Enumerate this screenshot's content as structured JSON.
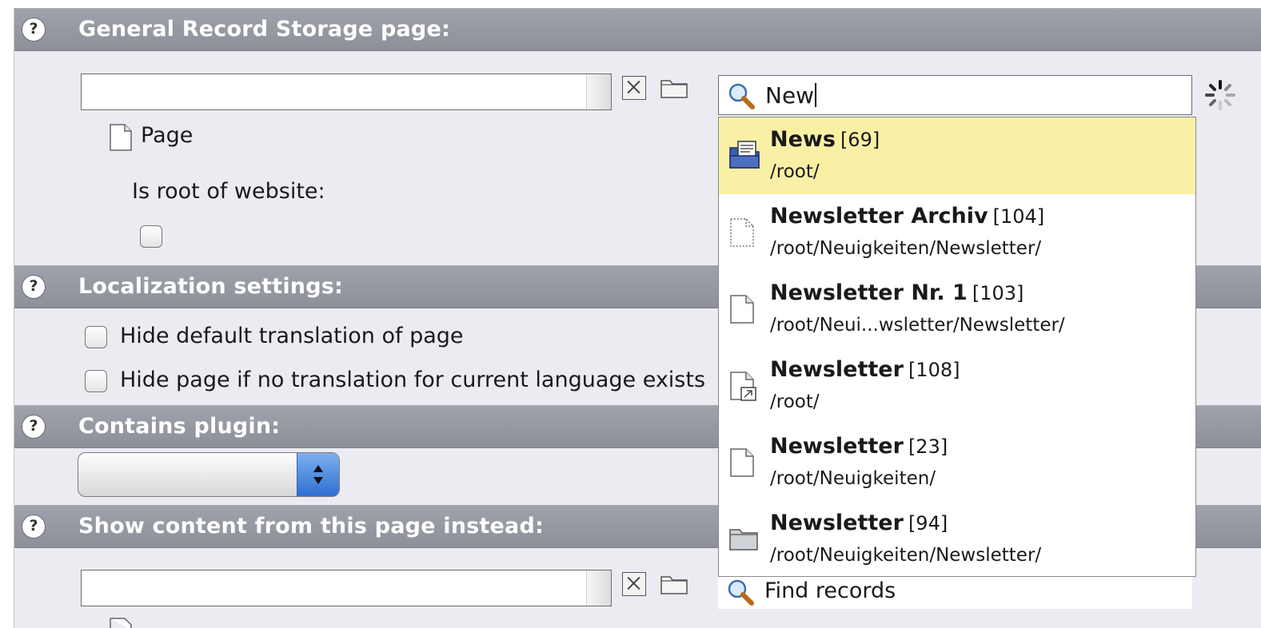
{
  "sections": {
    "general": {
      "title": "General Record Storage page:"
    },
    "localization": {
      "title": "Localization settings:"
    },
    "plugin": {
      "title": "Contains plugin:"
    },
    "show_content": {
      "title": "Show content from this page instead:"
    }
  },
  "help_glyph": "?",
  "general": {
    "page_label": "Page",
    "root_label": "Is root of website:"
  },
  "localization": {
    "hide_default_label": "Hide default translation of page",
    "hide_if_no_translation_label": "Hide page if no translation for current language exists"
  },
  "plugin": {
    "selected": ""
  },
  "search": {
    "value": "New",
    "find_label": "Find records"
  },
  "results": [
    {
      "title": "News",
      "id": "[69]",
      "path": "/root/",
      "icon": "news-folder-icon",
      "highlighted": true
    },
    {
      "title": "Newsletter Archiv",
      "id": "[104]",
      "path": "/root/Neuigkeiten/Newsletter/",
      "icon": "hidden-page-icon",
      "highlighted": false
    },
    {
      "title": "Newsletter Nr. 1",
      "id": "[103]",
      "path": "/root/Neui...wsletter/Newsletter/",
      "icon": "page-icon",
      "highlighted": false
    },
    {
      "title": "Newsletter",
      "id": "[108]",
      "path": "/root/",
      "icon": "shortcut-page-icon",
      "highlighted": false
    },
    {
      "title": "Newsletter",
      "id": "[23]",
      "path": "/root/Neuigkeiten/",
      "icon": "page-icon",
      "highlighted": false
    },
    {
      "title": "Newsletter",
      "id": "[94]",
      "path": "/root/Neuigkeiten/Newsletter/",
      "icon": "folder-icon",
      "highlighted": false
    }
  ],
  "colors": {
    "section_header": "#9598a1",
    "highlight": "#faf0a5",
    "background": "#ebebf1"
  }
}
